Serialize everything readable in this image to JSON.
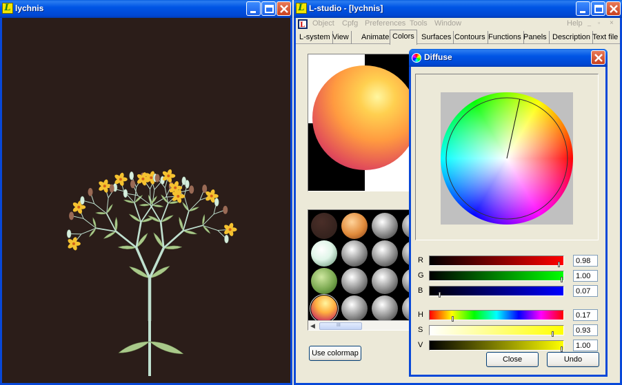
{
  "left_window": {
    "title": "lychnis"
  },
  "right_window": {
    "title": "L-studio - [lychnis]",
    "menu": [
      "Object",
      "Cpfg",
      "Preferences",
      "Tools",
      "Window"
    ],
    "menu_help": "Help",
    "tabs": [
      "L-system",
      "View",
      "Animate",
      "Colors",
      "Surfaces",
      "Contours",
      "Functions",
      "Panels",
      "Description",
      "Text file"
    ],
    "active_tab": "Colors",
    "use_colormap_label": "Use colormap",
    "scrollbar_grip": "III"
  },
  "dialog": {
    "title": "Diffuse",
    "sliders": [
      {
        "label": "R",
        "value": "0.98",
        "level": 0.98
      },
      {
        "label": "G",
        "value": "1.00",
        "level": 1.0
      },
      {
        "label": "B",
        "value": "0.07",
        "level": 0.07
      },
      {
        "label": "H",
        "value": "0.17",
        "level": 0.17
      },
      {
        "label": "S",
        "value": "0.93",
        "level": 0.93
      },
      {
        "label": "V",
        "value": "1.00",
        "level": 1.0
      }
    ],
    "close_label": "Close",
    "undo_label": "Undo"
  },
  "colors": {
    "plant_background": "#2b1d19",
    "stem": "#bfe0cf",
    "leaf": "#a9c98a",
    "flower": "#f5c230",
    "bud": "#9a6a55"
  }
}
